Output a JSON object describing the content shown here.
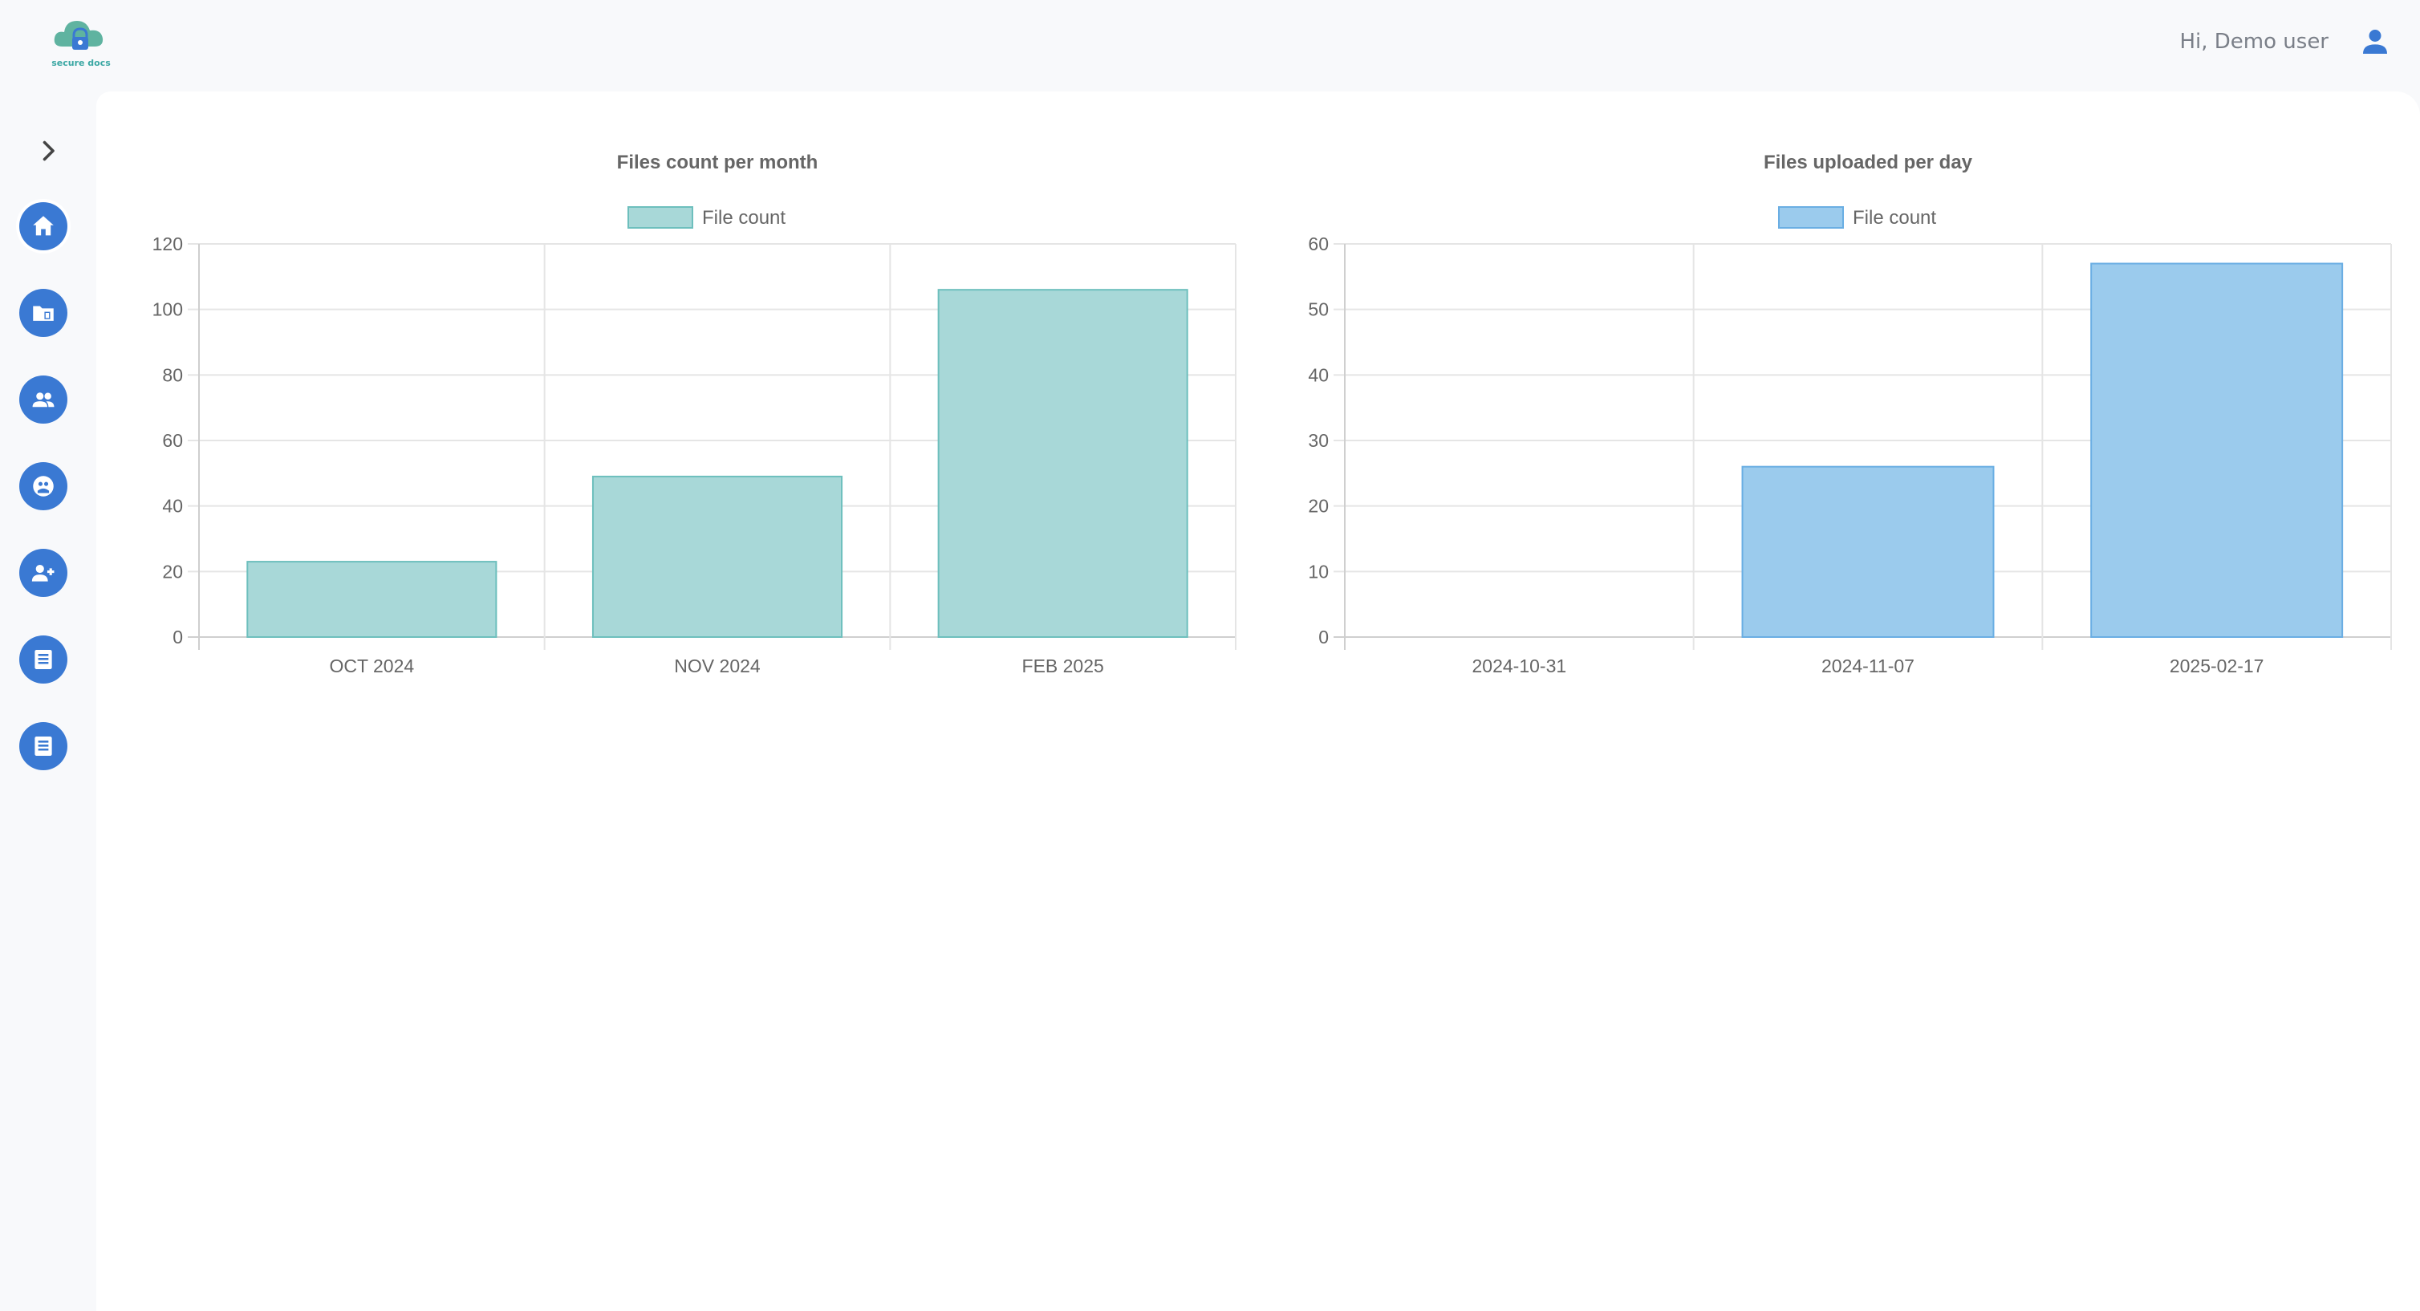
{
  "header": {
    "logo_text": "secure docs",
    "greeting": "Hi, Demo user",
    "user_icon": "person-icon"
  },
  "sidebar": {
    "toggle_icon": "chevron-right-icon",
    "items": [
      {
        "icon": "home-icon",
        "active": true
      },
      {
        "icon": "folder-file-icon",
        "active": false
      },
      {
        "icon": "users-icon",
        "active": false
      },
      {
        "icon": "support-icon",
        "active": false
      },
      {
        "icon": "add-user-icon",
        "active": false
      },
      {
        "icon": "document-list-icon",
        "active": false
      },
      {
        "icon": "document-list-icon",
        "active": false
      }
    ]
  },
  "colors": {
    "primary": "#3a79d3",
    "teal_fill": "#a8d8d8",
    "teal_border": "#6dbfbd",
    "blue_fill": "#9bcbed",
    "blue_border": "#6aaee3"
  },
  "chart_data": [
    {
      "type": "bar",
      "title": "Files count per month",
      "categories": [
        "OCT 2024",
        "NOV 2024",
        "FEB 2025"
      ],
      "series": [
        {
          "name": "File count",
          "values": [
            23,
            49,
            106
          ]
        }
      ],
      "ylim": [
        0,
        120
      ],
      "yticks": [
        0,
        20,
        40,
        60,
        80,
        100,
        120
      ],
      "grid": true,
      "legend": "top-center",
      "fill": "#a8d8d8",
      "border": "#6dbfbd"
    },
    {
      "type": "bar",
      "title": "Files uploaded per day",
      "categories": [
        "2024-10-31",
        "2024-11-07",
        "2025-02-17"
      ],
      "series": [
        {
          "name": "File count",
          "values": [
            0,
            26,
            57
          ]
        }
      ],
      "ylim": [
        0,
        60
      ],
      "yticks": [
        0,
        10,
        20,
        30,
        40,
        50,
        60
      ],
      "grid": true,
      "legend": "top-center",
      "fill": "#9bcbed",
      "border": "#6aaee3"
    }
  ]
}
